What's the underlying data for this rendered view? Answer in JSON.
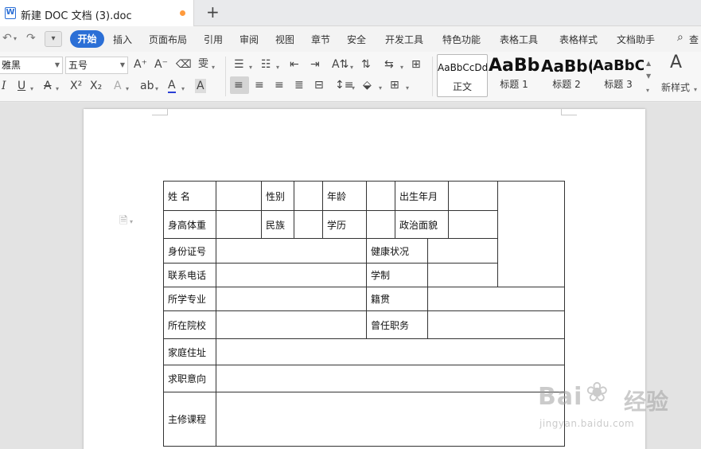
{
  "titlebar": {
    "doc_title": "新建 DOC 文档 (3).doc",
    "doc_icon": "W",
    "new_tab": "+"
  },
  "menubar": {
    "items": [
      "开始",
      "插入",
      "页面布局",
      "引用",
      "审阅",
      "视图",
      "章节",
      "安全",
      "开发工具",
      "特色功能",
      "表格工具",
      "表格样式",
      "文档助手"
    ],
    "search_label": "查",
    "qa_dropdown": "▾"
  },
  "ribbon": {
    "font_name": "雅黑",
    "font_size": "五号",
    "phonetic_glyph": "雯",
    "styles": [
      {
        "sample": "AaBbCcDd",
        "name": "正文"
      },
      {
        "sample": "AaBb",
        "name": "标题 1"
      },
      {
        "sample": "AaBb(",
        "name": "标题 2"
      },
      {
        "sample": "AaBbC(",
        "name": "标题 3"
      }
    ],
    "new_style_label": "新样式"
  },
  "table": {
    "row1": {
      "name": "姓 名",
      "gender": "性别",
      "age": "年龄",
      "birth": "出生年月"
    },
    "row2": {
      "height_weight": "身高体重",
      "ethnicity": "民族",
      "education": "学历",
      "political": "政治面貌"
    },
    "row3": {
      "id_no": "身份证号",
      "health": "健康状况"
    },
    "row4": {
      "phone": "联系电话",
      "schooling": "学制"
    },
    "row5": {
      "major": "所学专业",
      "native_place": "籍贯"
    },
    "row6": {
      "school": "所在院校",
      "positions": "曾任职务"
    },
    "row7": {
      "address": "家庭住址"
    },
    "row8": {
      "job_intent": "求职意向"
    },
    "row9": {
      "courses": "主修课程"
    }
  },
  "watermark": {
    "brand": "Bai",
    "brand_cn": "经验",
    "url": "jingyan.baidu.com"
  },
  "colors": {
    "accent": "#2b6fd6",
    "tab_dot": "#ff9a3c",
    "page_bg": "#ffffff",
    "canvas_bg": "#e3e3e3"
  }
}
